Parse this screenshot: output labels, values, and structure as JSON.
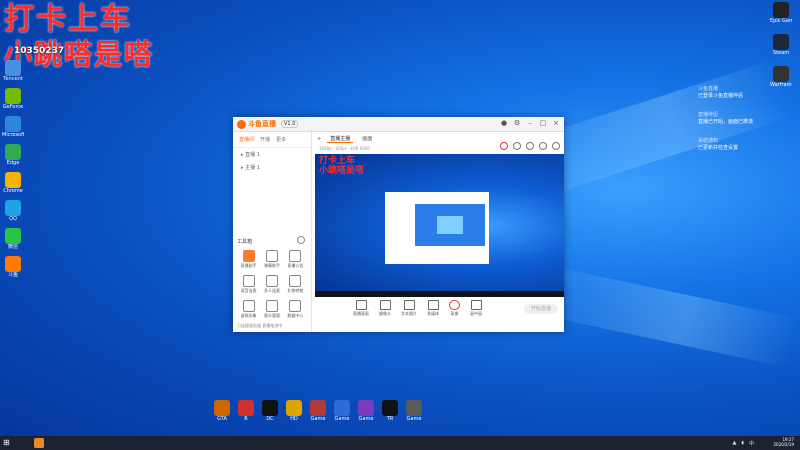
{
  "overlay": {
    "title": "打卡上车",
    "subtitle": "小跳嗒是嗒",
    "room_id": "10350237"
  },
  "desktop_left": [
    {
      "label": "Tencent",
      "color": "#4a90e2"
    },
    {
      "label": "GeForce",
      "color": "#76b900"
    },
    {
      "label": "Microsoft",
      "color": "#2b88d8"
    },
    {
      "label": "Edge",
      "color": "#32a852"
    },
    {
      "label": "Chrome",
      "color": "#f2b400"
    },
    {
      "label": "QQ",
      "color": "#1fa3e8"
    },
    {
      "label": "微信",
      "color": "#28c445"
    },
    {
      "label": "斗鱼",
      "color": "#ff7a00"
    }
  ],
  "desktop_right": [
    {
      "label": "Epic Games",
      "color": "#222222"
    },
    {
      "label": "Steam",
      "color": "#1b2838"
    },
    {
      "label": "Warframe",
      "color": "#333333"
    }
  ],
  "notifications": [
    {
      "header": "斗鱼直播",
      "body": "已登录斗鱼直播伴侣"
    },
    {
      "header": "直播伴侣",
      "body": "直播已开始，画面已推流"
    },
    {
      "header": "系统通知",
      "body": "已更新并检查设置"
    }
  ],
  "app": {
    "logo": "斗鱼直播",
    "version": "V1.0",
    "left_tabs": [
      "直播间",
      "开播",
      "更多"
    ],
    "tree": [
      "直播 1",
      "主播 1"
    ],
    "tool_heading": "工具箱",
    "tools": [
      {
        "label": "直播助手",
        "hot": true
      },
      {
        "label": "弹幕助手",
        "hot": false
      },
      {
        "label": "直播公告",
        "hot": false
      },
      {
        "label": "语音连麦",
        "hot": false
      },
      {
        "label": "多人连麦",
        "hot": false
      },
      {
        "label": "礼物特效",
        "hot": false
      },
      {
        "label": "虚拟形象",
        "hot": false
      },
      {
        "label": "观众管理",
        "hot": false
      },
      {
        "label": "数据中心",
        "hot": false
      }
    ],
    "footer": "已连接服务器 直播推流中",
    "main_tabs": [
      "直播主播",
      "画面"
    ],
    "stream_info": "1080p · 60fps · 码率 6000",
    "preview_title": "打卡上车\n小跳嗒是嗒",
    "bottom_tools": [
      {
        "label": "直播画面"
      },
      {
        "label": "摄像头"
      },
      {
        "label": "文本图片"
      },
      {
        "label": "多媒体"
      },
      {
        "label": "录像"
      },
      {
        "label": "画中画"
      }
    ],
    "go_live": "开始直播"
  },
  "bottom_desktop": [
    {
      "label": "GTA",
      "color": "#cc6600"
    },
    {
      "label": "R",
      "color": "#d32f2f"
    },
    {
      "label": "DC",
      "color": "#111111"
    },
    {
      "label": "HD",
      "color": "#e0a400"
    },
    {
      "label": "Game",
      "color": "#b23a3a"
    },
    {
      "label": "Game",
      "color": "#2f6bd8"
    },
    {
      "label": "Game",
      "color": "#7a3bbd"
    },
    {
      "label": "TR",
      "color": "#111111"
    },
    {
      "label": "Game",
      "color": "#5a5a5a"
    }
  ],
  "taskbar": {
    "time": "19:27",
    "date": "2020/2/19"
  }
}
